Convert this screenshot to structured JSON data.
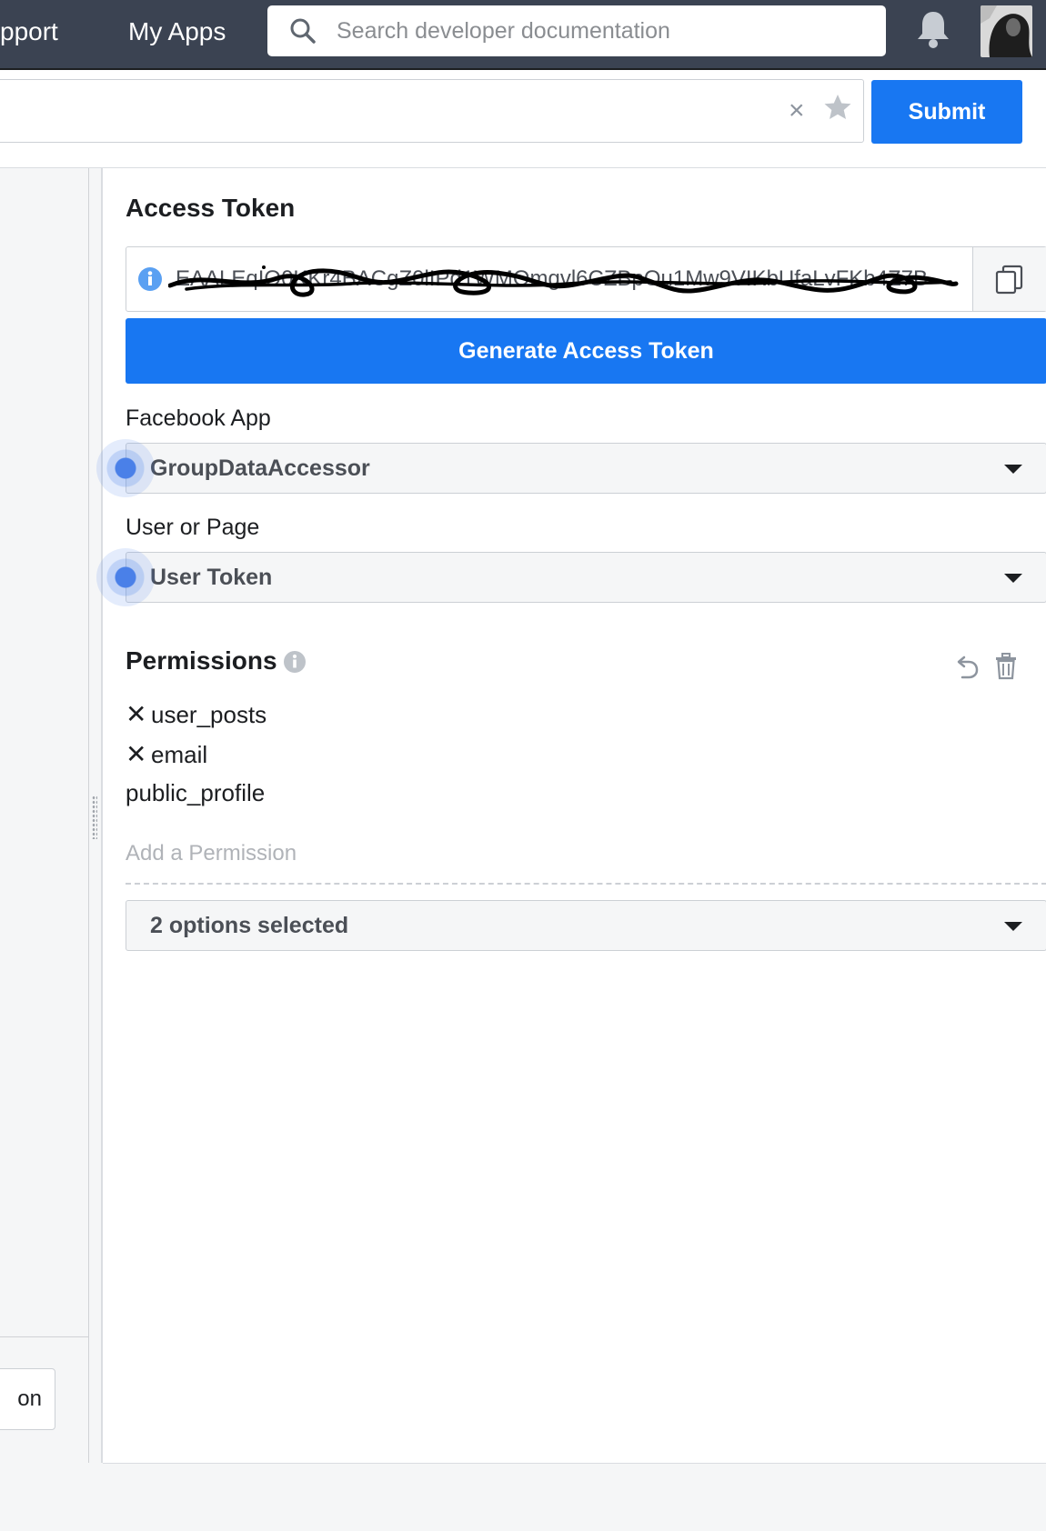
{
  "topnav": {
    "support_fragment": "pport",
    "my_apps": "My Apps"
  },
  "search": {
    "placeholder": "Search developer documentation"
  },
  "url_row": {
    "submit_label": "Submit",
    "clear_glyph": "×"
  },
  "left_pane": {
    "button_fragment": "on"
  },
  "access_token": {
    "title": "Access Token",
    "token_value": "EAALEqIO0KKr4BACgZ0lIPd1WMOmgvl6CZBpOu1Mw9VIKbUfaLvFKb4Z7B",
    "generate_label": "Generate Access Token"
  },
  "facebook_app": {
    "label": "Facebook App",
    "selected": "GroupDataAccessor"
  },
  "user_or_page": {
    "label": "User or Page",
    "selected": "User Token"
  },
  "permissions": {
    "title": "Permissions",
    "items": [
      {
        "name": "user_posts",
        "removable": true,
        "remove_glyph": "✕"
      },
      {
        "name": "email",
        "removable": true,
        "remove_glyph": "✕"
      },
      {
        "name": "public_profile",
        "removable": false
      }
    ],
    "add_placeholder": "Add a Permission",
    "options_summary": "2 options selected"
  },
  "colors": {
    "accent": "#1877f2",
    "topbar": "#3b4352",
    "focus_ring": "#4a80e8"
  },
  "icons": [
    "search-icon",
    "bell-icon",
    "avatar",
    "clear-icon",
    "star-icon",
    "info-icon",
    "copy-icon",
    "undo-icon",
    "trash-icon",
    "chevron-down-icon"
  ]
}
